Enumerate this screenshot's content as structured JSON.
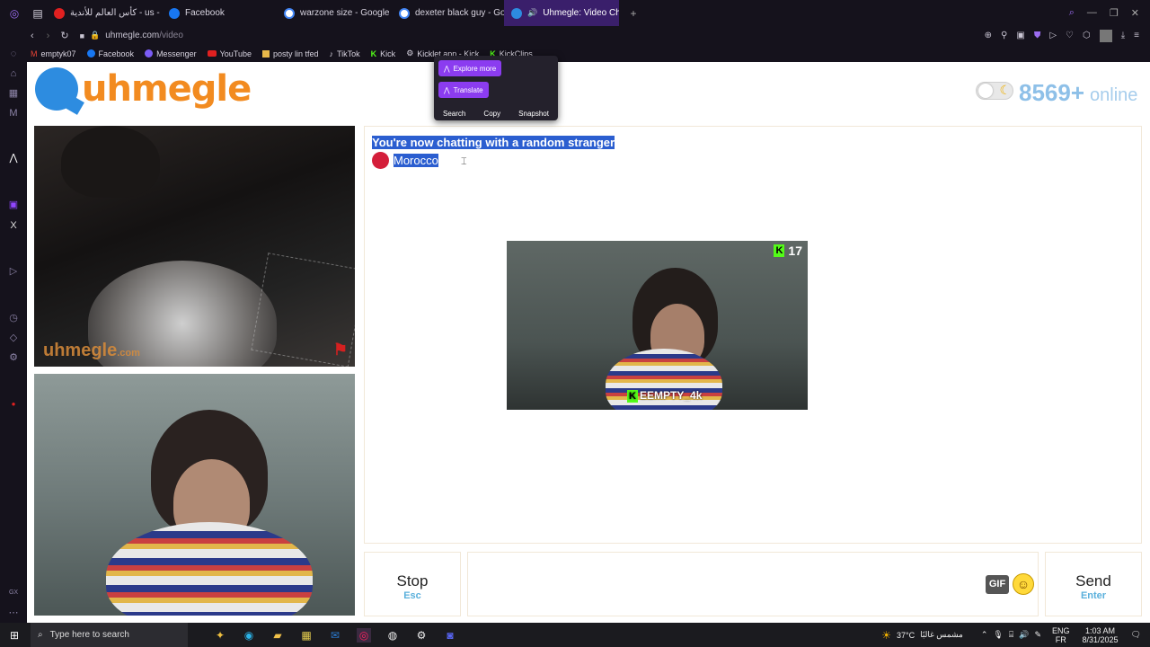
{
  "tabs": [
    {
      "title": "كأس العالم للأندية - us - قد",
      "active": false,
      "color": "#e02020"
    },
    {
      "title": "Facebook",
      "active": false,
      "color": "#1877f2"
    },
    {
      "title": "warzone size - Google Se",
      "active": false,
      "color": "#4285f4"
    },
    {
      "title": "dexeter black guy - Goog",
      "active": false,
      "color": "#4285f4"
    },
    {
      "title": "Uhmegle: Video Chat",
      "active": true,
      "color": "#2d8ce0"
    }
  ],
  "address": {
    "domain": "uhmegle.com",
    "path": "/video"
  },
  "bookmarks": [
    "emptyk07",
    "Facebook",
    "Messenger",
    "YouTube",
    "posty lin tfed",
    "TikTok",
    "Kick",
    "Kicklet app - Kick",
    "KickClips"
  ],
  "page": {
    "logo_text": "uhmegle",
    "online_count": "8569+",
    "online_label": "online",
    "watermark": "uhmegle",
    "watermark_suffix": ".com"
  },
  "chat": {
    "status_message": "You're now chatting with a random stranger",
    "country": "Morocco"
  },
  "stream": {
    "viewer_count": "17",
    "streamer_tag": "EEMPTY_4k"
  },
  "controls": {
    "stop_label": "Stop",
    "stop_key": "Esc",
    "send_label": "Send",
    "send_key": "Enter",
    "gif_label": "GIF"
  },
  "popup": {
    "explore_label": "Explore more",
    "translate_label": "Translate",
    "search_label": "Search",
    "copy_label": "Copy",
    "snapshot_label": "Snapshot"
  },
  "taskbar": {
    "search_placeholder": "Type here to search",
    "weather_temp": "37°C",
    "weather_desc": "مشمس غالبًا",
    "lang_top": "ENG",
    "lang_bottom": "FR",
    "time": "1:03 AM",
    "date": "8/31/2025"
  }
}
